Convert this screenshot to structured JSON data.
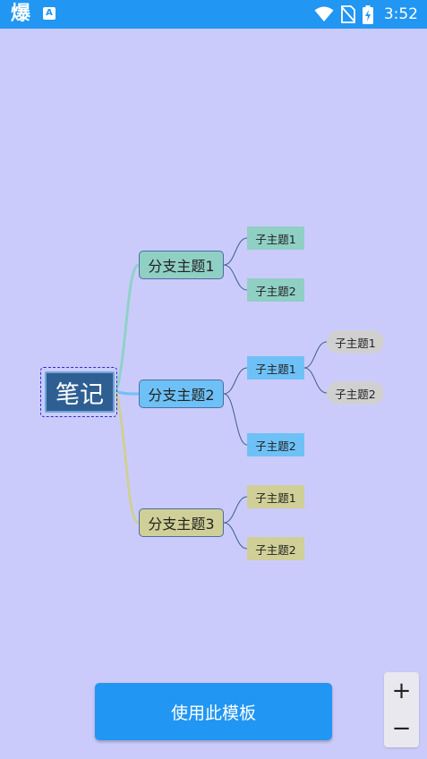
{
  "status_bar": {
    "app_icon_glyph": "爆",
    "notification_icon_glyph": "A",
    "time": "3:52"
  },
  "mindmap": {
    "root": "笔记",
    "branches": [
      {
        "label": "分支主题1",
        "color": "#8fcfc4",
        "children": [
          {
            "label": "子主题1"
          },
          {
            "label": "子主题2"
          }
        ]
      },
      {
        "label": "分支主题2",
        "color": "#6ec1f7",
        "children": [
          {
            "label": "子主题1",
            "children": [
              {
                "label": "子主题1"
              },
              {
                "label": "子主题2"
              }
            ]
          },
          {
            "label": "子主题2"
          }
        ]
      },
      {
        "label": "分支主题3",
        "color": "#cfcf97",
        "children": [
          {
            "label": "子主题1"
          },
          {
            "label": "子主题2"
          }
        ]
      }
    ]
  },
  "actions": {
    "use_template": "使用此模板",
    "zoom_in": "+",
    "zoom_out": "−"
  },
  "colors": {
    "background": "#cbcbfb",
    "accent": "#2196f3",
    "root_fill": "#2f5f92"
  }
}
